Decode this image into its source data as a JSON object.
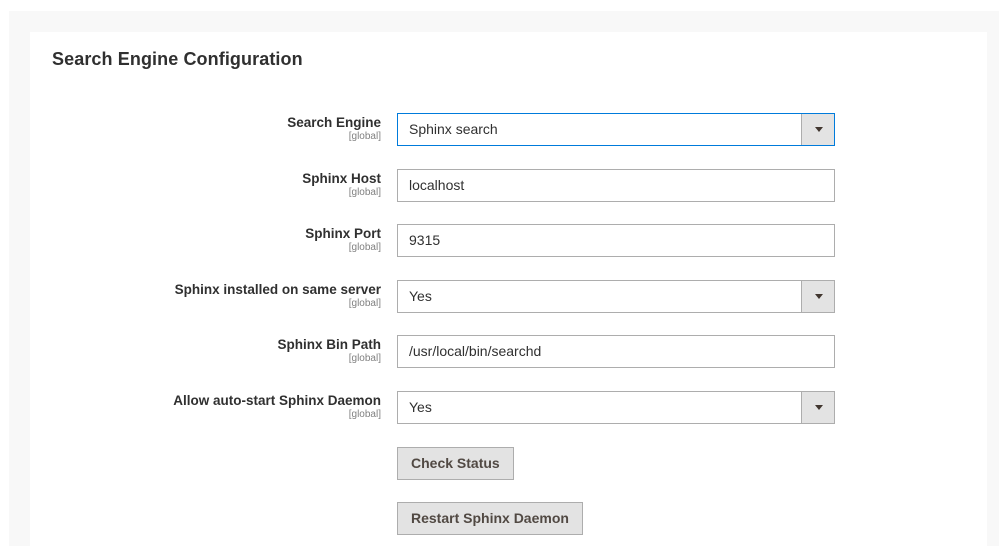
{
  "section": {
    "title": "Search Engine Configuration"
  },
  "fields": [
    {
      "label": "Search Engine",
      "scope": "[global]",
      "value": "Sphinx search",
      "type": "select",
      "focused": true
    },
    {
      "label": "Sphinx Host",
      "scope": "[global]",
      "value": "localhost",
      "type": "text"
    },
    {
      "label": "Sphinx Port",
      "scope": "[global]",
      "value": "9315",
      "type": "text"
    },
    {
      "label": "Sphinx installed on same server",
      "scope": "[global]",
      "value": "Yes",
      "type": "select"
    },
    {
      "label": "Sphinx Bin Path",
      "scope": "[global]",
      "value": "/usr/local/bin/searchd",
      "type": "text"
    },
    {
      "label": "Allow auto-start Sphinx Daemon",
      "scope": "[global]",
      "value": "Yes",
      "type": "select"
    }
  ],
  "buttons": {
    "check_status": "Check Status",
    "restart_daemon": "Restart Sphinx Daemon"
  },
  "icons": {
    "select_arrow": "chevron-down-icon"
  },
  "colors": {
    "focus_border": "#007bdb",
    "input_border": "#adadad",
    "button_bg": "#e3e3e3",
    "button_text": "#514943",
    "panel_bg": "#ffffff",
    "page_bg": "#f8f8f8"
  }
}
